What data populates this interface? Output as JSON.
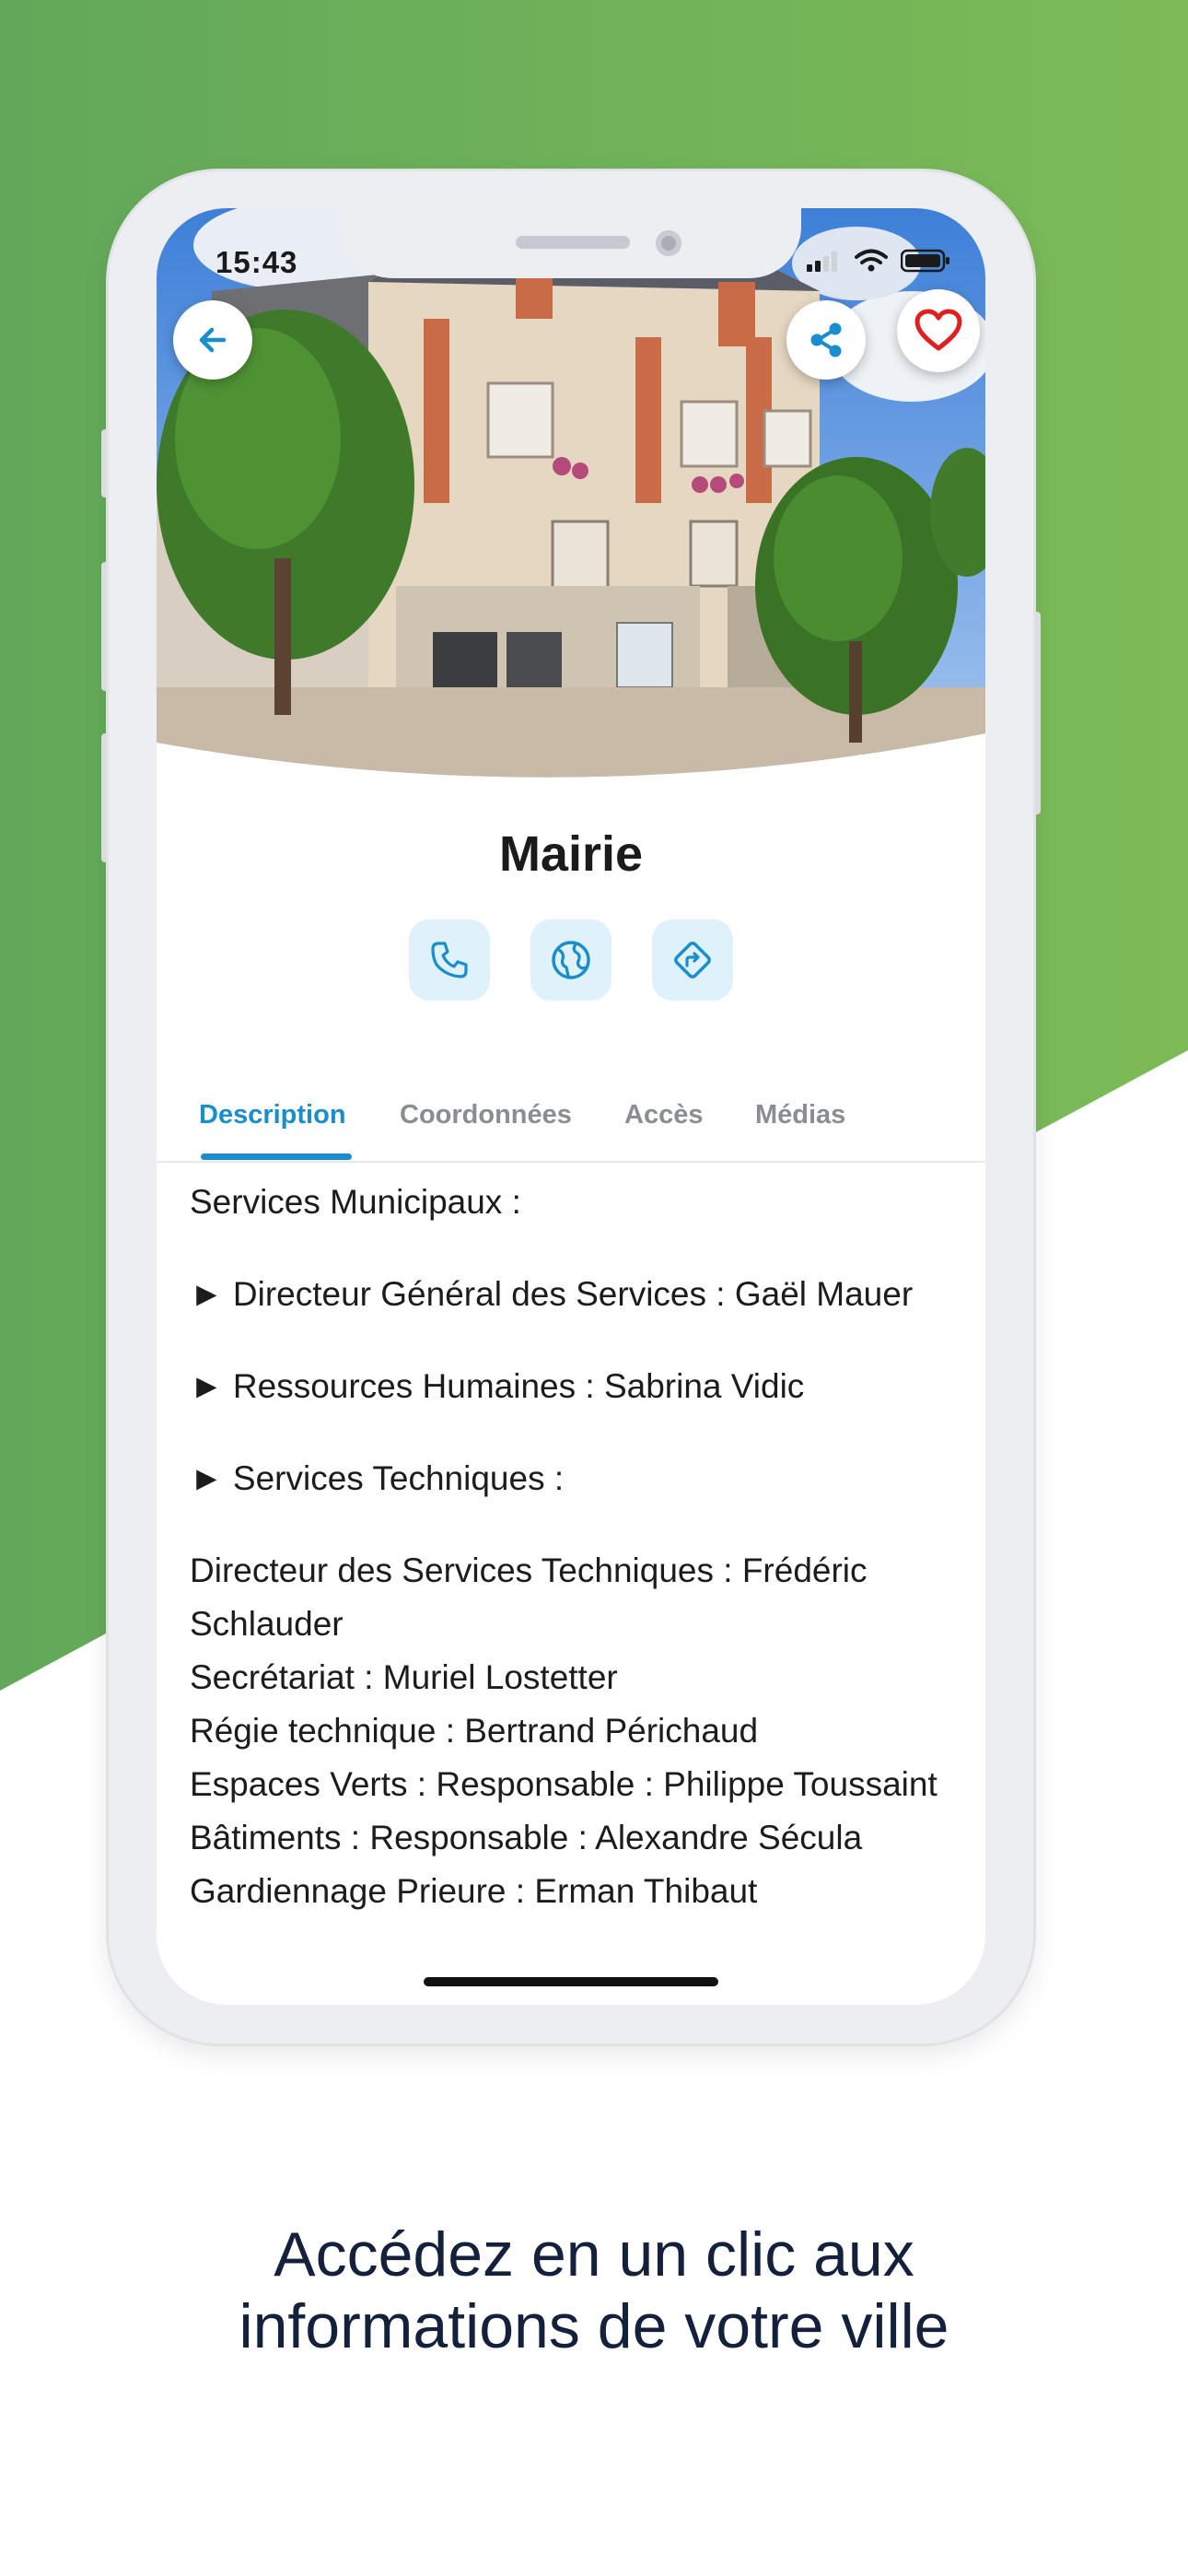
{
  "colors": {
    "green": "#6fb35b",
    "accent": "#1a8dcc",
    "heart": "#e02020",
    "caption": "#14213d"
  },
  "status_bar": {
    "time": "15:43"
  },
  "header": {
    "back_icon": "arrow-left-icon",
    "share_icon": "share-icon",
    "favorite_icon": "heart-icon"
  },
  "place": {
    "title": "Mairie",
    "actions": [
      {
        "name": "phone-icon"
      },
      {
        "name": "globe-icon"
      },
      {
        "name": "directions-icon"
      }
    ]
  },
  "tabs": [
    {
      "label": "Description",
      "active": true
    },
    {
      "label": "Coordonnées"
    },
    {
      "label": "Accès"
    },
    {
      "label": "Médias"
    }
  ],
  "description": {
    "intro": "Services Municipaux :",
    "item1": "► Directeur Général des Services : Gaël Mauer",
    "item2": "► Ressources Humaines : Sabrina Vidic",
    "item3": "► Services Techniques :",
    "lines": [
      "Directeur des Services Techniques : Frédéric Schlauder",
      "Secrétariat : Muriel Lostetter",
      "Régie technique : Bertrand Périchaud",
      "Espaces Verts : Responsable : Philippe Toussaint",
      "Bâtiments : Responsable : Alexandre Sécula",
      "Gardiennage Prieure : Erman Thibaut"
    ]
  },
  "caption": {
    "line1": "Accédez en un clic aux",
    "line2": "informations de votre ville"
  }
}
